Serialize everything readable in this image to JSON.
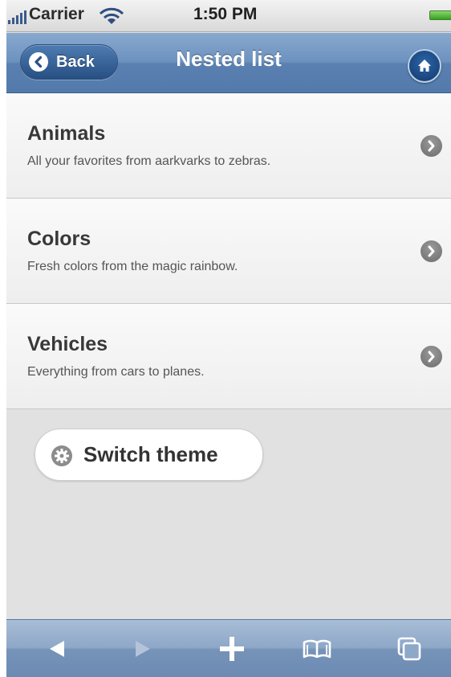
{
  "status_bar": {
    "carrier": "Carrier",
    "time": "1:50 PM"
  },
  "nav": {
    "back_label": "Back",
    "title": "Nested list"
  },
  "list": {
    "items": [
      {
        "title": "Animals",
        "description": "All your favorites from aarkvarks to zebras."
      },
      {
        "title": "Colors",
        "description": "Fresh colors from the magic rainbow."
      },
      {
        "title": "Vehicles",
        "description": "Everything from cars to planes."
      }
    ]
  },
  "switch_theme": {
    "label": "Switch theme"
  },
  "icons": {
    "signal": "signal-bars-icon",
    "wifi": "wifi-icon",
    "battery": "battery-icon",
    "back": "chevron-left-icon",
    "home": "home-icon",
    "disclosure": "chevron-right-icon",
    "gear": "gear-icon",
    "toolbar": [
      "back-arrow-icon",
      "forward-arrow-icon",
      "add-icon",
      "bookmarks-icon",
      "pages-icon"
    ]
  },
  "colors": {
    "nav_bar": "#6d92bf",
    "toolbar": "#8ea8c8",
    "background": "#e1e1e1",
    "list_item": "#f4f4f4",
    "battery": "#37a01f"
  }
}
